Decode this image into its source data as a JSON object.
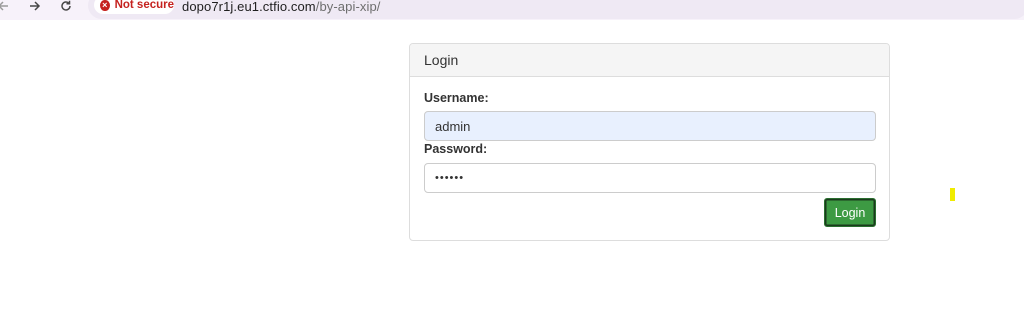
{
  "browser": {
    "back_icon": "arrow-left-icon",
    "forward_icon": "arrow-right-icon",
    "reload_icon": "reload-icon",
    "security_label": "Not secure",
    "url_host": "dopo7r1j.eu1.ctfio.com",
    "url_path": "/by-api-xip/"
  },
  "login": {
    "heading": "Login",
    "username_label": "Username:",
    "username_value": "admin",
    "password_label": "Password:",
    "password_value": "••••••",
    "submit_label": "Login"
  },
  "colors": {
    "button": "#3d9a43",
    "autofill": "#e8f0fe",
    "marker": "#f0ec00",
    "warning": "#c5221f"
  }
}
